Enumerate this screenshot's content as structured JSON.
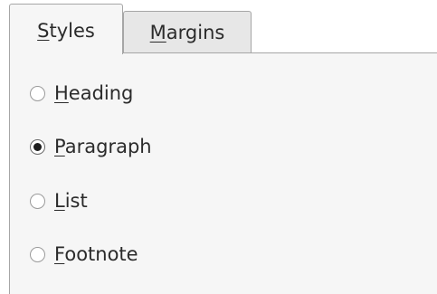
{
  "tabs": [
    {
      "mnemonic": "S",
      "rest": "tyles",
      "active": true
    },
    {
      "mnemonic": "M",
      "rest": "argins",
      "active": false
    }
  ],
  "options": [
    {
      "mnemonic": "H",
      "rest": "eading",
      "checked": false
    },
    {
      "mnemonic": "P",
      "rest": "aragraph",
      "checked": true
    },
    {
      "mnemonic": "L",
      "rest": "ist",
      "checked": false
    },
    {
      "mnemonic": "F",
      "rest": "ootnote",
      "checked": false
    }
  ]
}
